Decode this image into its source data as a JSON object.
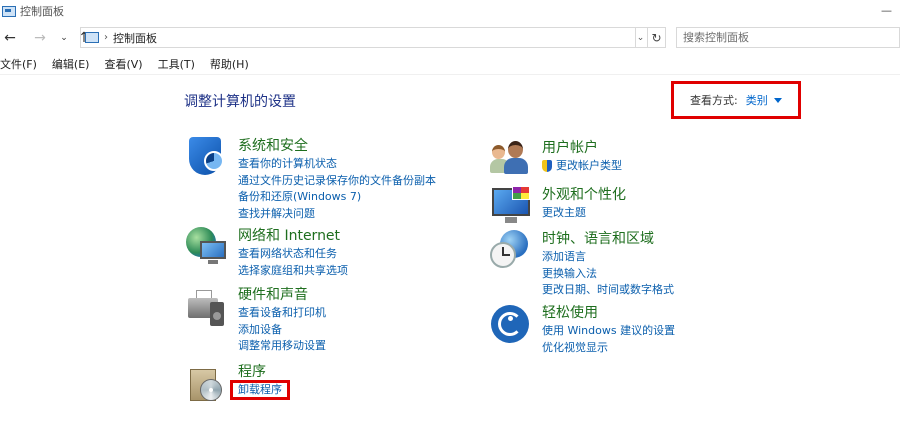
{
  "window": {
    "title": "控制面板",
    "minimize_glyph": "—"
  },
  "nav": {
    "back_glyph": "←",
    "forward_glyph": "→",
    "recent_glyph": "⌄",
    "up_glyph": "↑",
    "breadcrumb_sep": "›",
    "breadcrumb": "控制面板",
    "dropdown_glyph": "⌄",
    "refresh_glyph": "↻",
    "search_placeholder": "搜索控制面板"
  },
  "menu": [
    "文件(F)",
    "编辑(E)",
    "查看(V)",
    "工具(T)",
    "帮助(H)"
  ],
  "page": {
    "title": "调整计算机的设置",
    "view_by_label": "查看方式:",
    "view_by_value": "类别"
  },
  "categories": {
    "security": {
      "title": "系统和安全",
      "icon": "shield-icon",
      "links": [
        "查看你的计算机状态",
        "通过文件历史记录保存你的文件备份副本",
        "备份和还原(Windows 7)",
        "查找并解决问题"
      ]
    },
    "network": {
      "title": "网络和 Internet",
      "icon": "network-globe-icon",
      "links": [
        "查看网络状态和任务",
        "选择家庭组和共享选项"
      ]
    },
    "hardware": {
      "title": "硬件和声音",
      "icon": "printer-speaker-icon",
      "links": [
        "查看设备和打印机",
        "添加设备",
        "调整常用移动设置"
      ]
    },
    "programs": {
      "title": "程序",
      "icon": "programs-disc-icon",
      "links": [
        "卸载程序"
      ]
    },
    "accounts": {
      "title": "用户帐户",
      "icon": "users-icon",
      "links": [
        "更改帐户类型"
      ]
    },
    "appearance": {
      "title": "外观和个性化",
      "icon": "monitor-palette-icon",
      "links": [
        "更改主题"
      ]
    },
    "clock": {
      "title": "时钟、语言和区域",
      "icon": "clock-globe-icon",
      "links": [
        "添加语言",
        "更换输入法",
        "更改日期、时间或数字格式"
      ]
    },
    "access": {
      "title": "轻松使用",
      "icon": "ease-of-access-icon",
      "links": [
        "使用 Windows 建议的设置",
        "优化视觉显示"
      ]
    }
  },
  "colors": {
    "category_title": "#1e6e1e",
    "link": "#0b5fad",
    "heading": "#1e3287",
    "highlight": "#e00000"
  }
}
